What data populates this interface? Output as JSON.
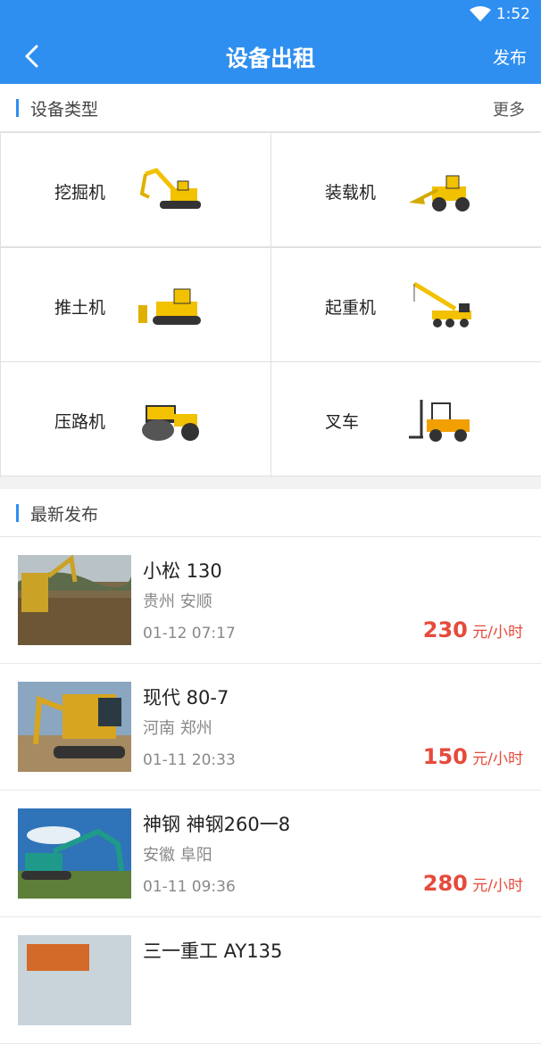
{
  "status": {
    "time": "1:52"
  },
  "nav": {
    "title": "设备出租",
    "publish": "发布"
  },
  "types_section": {
    "label": "设备类型",
    "more": "更多"
  },
  "equipment_types": [
    {
      "label": "挖掘机",
      "icon": "excavator-icon"
    },
    {
      "label": "装载机",
      "icon": "loader-icon"
    },
    {
      "label": "推土机",
      "icon": "bulldozer-icon"
    },
    {
      "label": "起重机",
      "icon": "crane-icon"
    },
    {
      "label": "压路机",
      "icon": "road-roller-icon"
    },
    {
      "label": "叉车",
      "icon": "forklift-icon"
    }
  ],
  "latest_section": {
    "label": "最新发布"
  },
  "listings": [
    {
      "title": "小松 130",
      "location": "贵州 安顺",
      "date": "01-12 07:17",
      "price": "230",
      "unit": " 元/小时"
    },
    {
      "title": "现代 80-7",
      "location": "河南 郑州",
      "date": "01-11 20:33",
      "price": "150",
      "unit": " 元/小时"
    },
    {
      "title": "神钢 神钢260一8",
      "location": "安徽 阜阳",
      "date": "01-11 09:36",
      "price": "280",
      "unit": " 元/小时"
    },
    {
      "title": "三一重工 AY135",
      "location": "",
      "date": "",
      "price": "",
      "unit": ""
    }
  ],
  "colors": {
    "primary": "#2f8ff0",
    "price": "#e64a3b"
  }
}
